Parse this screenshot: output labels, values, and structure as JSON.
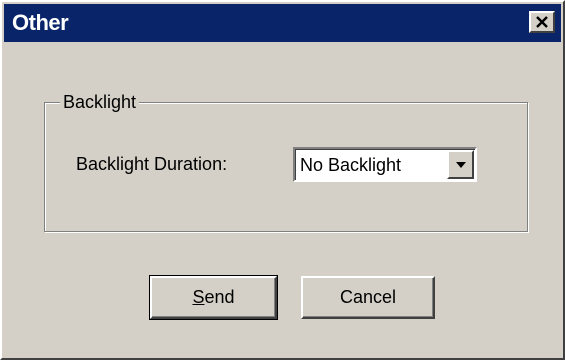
{
  "window": {
    "title": "Other",
    "close_icon": "close-icon"
  },
  "group": {
    "legend": "Backlight",
    "duration_label": "Backlight Duration:",
    "duration_value": "No Backlight",
    "dropdown_icon": "chevron-down-icon"
  },
  "buttons": {
    "send_mnemonic": "S",
    "send_rest": "end",
    "cancel_label": "Cancel"
  },
  "colors": {
    "titlebar": "#0a246a",
    "face": "#d4d0c8"
  }
}
